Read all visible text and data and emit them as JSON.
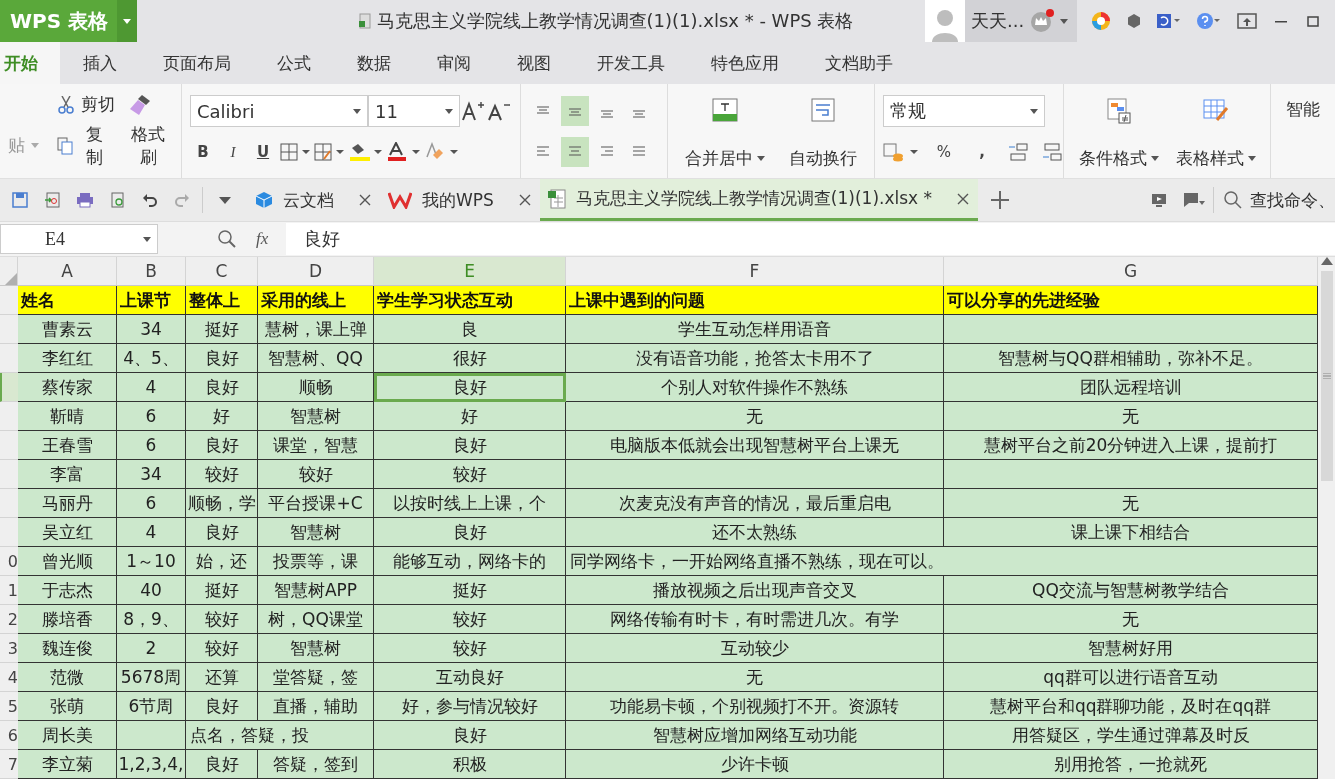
{
  "app_button": {
    "label": "WPS 表格"
  },
  "window": {
    "title": "马克思主义学院线上教学情况调查(1)(1).xlsx * - WPS 表格"
  },
  "user": {
    "name": "天天..."
  },
  "menu_tabs": [
    {
      "label": "开始",
      "selected": true
    },
    {
      "label": "插入",
      "selected": false
    },
    {
      "label": "页面布局",
      "selected": false
    },
    {
      "label": "公式",
      "selected": false
    },
    {
      "label": "数据",
      "selected": false
    },
    {
      "label": "审阅",
      "selected": false
    },
    {
      "label": "视图",
      "selected": false
    },
    {
      "label": "开发工具",
      "selected": false
    },
    {
      "label": "特色应用",
      "selected": false
    },
    {
      "label": "文档助手",
      "selected": false
    }
  ],
  "ribbon": {
    "paste": "贴",
    "cut": "剪切",
    "copy": "复制",
    "format_painter": "格式刷",
    "font_family": "Calibri",
    "font_size": "11",
    "bold": "B",
    "italic": "I",
    "underline": "U",
    "merge_center": "合并居中",
    "wrap_text": "自动换行",
    "number_format": "常规",
    "percent": "%",
    "comma": ",",
    "conditional_format": "条件格式",
    "table_style": "表格样式",
    "smart": "智能"
  },
  "doc_tabs": [
    {
      "label": "云文档",
      "selected": false
    },
    {
      "label": "我的WPS",
      "selected": false
    },
    {
      "label": "马克思主义学院线上教学情况调查(1)(1).xlsx *",
      "selected": true
    }
  ],
  "search": {
    "placeholder": "查找命令、"
  },
  "formula_bar": {
    "cell_ref": "E4",
    "fx": "fx",
    "value": "良好"
  },
  "sheet": {
    "columns": [
      {
        "label": "A",
        "selected": false
      },
      {
        "label": "B",
        "selected": false
      },
      {
        "label": "C",
        "selected": false
      },
      {
        "label": "D",
        "selected": false
      },
      {
        "label": "E",
        "selected": true
      },
      {
        "label": "F",
        "selected": false
      },
      {
        "label": "G",
        "selected": false
      }
    ],
    "header_row": [
      "姓名",
      "上课节",
      "整体上",
      "采用的线上",
      "学生学习状态互动",
      "上课中遇到的问题",
      "可以分享的先进经验"
    ],
    "rows": [
      {
        "selected": false,
        "cells": [
          {
            "text": "曹素云"
          },
          {
            "text": "34"
          },
          {
            "text": "挺好"
          },
          {
            "text": "慧树，课上弹"
          },
          {
            "text": "良"
          },
          {
            "text": "学生互动怎样用语音"
          },
          {
            "text": ""
          }
        ]
      },
      {
        "selected": false,
        "cells": [
          {
            "text": "李红红"
          },
          {
            "text": "4、5、"
          },
          {
            "text": "良好"
          },
          {
            "text": "智慧树、QQ"
          },
          {
            "text": "很好"
          },
          {
            "text": "没有语音功能，抢答太卡用不了"
          },
          {
            "text": "智慧树与QQ群相辅助，弥补不足。"
          }
        ]
      },
      {
        "selected": true,
        "cells": [
          {
            "text": "蔡传家"
          },
          {
            "text": "4"
          },
          {
            "text": "良好"
          },
          {
            "text": "顺畅"
          },
          {
            "text": "良好"
          },
          {
            "text": "个别人对软件操作不熟练"
          },
          {
            "text": "团队远程培训"
          }
        ]
      },
      {
        "selected": false,
        "cells": [
          {
            "text": "靳晴"
          },
          {
            "text": "6"
          },
          {
            "text": "好"
          },
          {
            "text": "智慧树"
          },
          {
            "text": "好"
          },
          {
            "text": "无"
          },
          {
            "text": "无"
          }
        ]
      },
      {
        "selected": false,
        "cells": [
          {
            "text": "王春雪"
          },
          {
            "text": "6"
          },
          {
            "text": "良好"
          },
          {
            "text": "课堂，智慧"
          },
          {
            "text": "良好"
          },
          {
            "text": "电脑版本低就会出现智慧树平台上课无"
          },
          {
            "text": "慧树平台之前20分钟进入上课，提前打"
          }
        ]
      },
      {
        "selected": false,
        "cells": [
          {
            "text": "李富"
          },
          {
            "text": "34"
          },
          {
            "text": "较好"
          },
          {
            "text": "较好"
          },
          {
            "text": "较好"
          },
          {
            "text": ""
          },
          {
            "text": ""
          }
        ]
      },
      {
        "selected": false,
        "cells": [
          {
            "text": "马丽丹"
          },
          {
            "text": "6"
          },
          {
            "text": "顺畅，学"
          },
          {
            "text": "平台授课+C"
          },
          {
            "text": "以按时线上上课，个"
          },
          {
            "text": "次麦克没有声音的情况，最后重启电"
          },
          {
            "text": "无"
          }
        ]
      },
      {
        "selected": false,
        "cells": [
          {
            "text": "吴立红"
          },
          {
            "text": "4"
          },
          {
            "text": "良好"
          },
          {
            "text": "智慧树"
          },
          {
            "text": "良好"
          },
          {
            "text": "还不太熟练"
          },
          {
            "text": "课上课下相结合"
          }
        ]
      },
      {
        "number": "0",
        "selected": false,
        "cells": [
          {
            "text": "曾光顺"
          },
          {
            "text": "1～10"
          },
          {
            "text": "始，还"
          },
          {
            "text": "投票等，课"
          },
          {
            "text": "能够互动，网络卡的"
          },
          {
            "text": "同学网络卡，一开始网络直播不熟练，现在可以。",
            "kind": "spill"
          },
          {
            "text": ""
          }
        ]
      },
      {
        "number": "1",
        "selected": false,
        "cells": [
          {
            "text": "于志杰"
          },
          {
            "text": "40"
          },
          {
            "text": "挺好"
          },
          {
            "text": "智慧树APP"
          },
          {
            "text": "挺好"
          },
          {
            "text": "播放视频之后出现声音交叉"
          },
          {
            "text": "QQ交流与智慧树教学结合"
          }
        ]
      },
      {
        "number": "2",
        "selected": false,
        "cells": [
          {
            "text": "滕培香"
          },
          {
            "text": "8，9、"
          },
          {
            "text": "较好"
          },
          {
            "text": "树，QQ课堂"
          },
          {
            "text": "较好"
          },
          {
            "text": "网络传输有时卡，有时需进几次。有学"
          },
          {
            "text": "无"
          }
        ]
      },
      {
        "number": "3",
        "selected": false,
        "cells": [
          {
            "text": "魏连俊"
          },
          {
            "text": "2"
          },
          {
            "text": "较好"
          },
          {
            "text": "智慧树"
          },
          {
            "text": "较好"
          },
          {
            "text": "互动较少"
          },
          {
            "text": "智慧树好用"
          }
        ]
      },
      {
        "number": "4",
        "selected": false,
        "cells": [
          {
            "text": "范微"
          },
          {
            "text": "5678周"
          },
          {
            "text": "还算"
          },
          {
            "text": "堂答疑，签"
          },
          {
            "text": "互动良好"
          },
          {
            "text": "无"
          },
          {
            "text": "qq群可以进行语音互动"
          }
        ]
      },
      {
        "number": "5",
        "selected": false,
        "cells": [
          {
            "text": "张萌"
          },
          {
            "text": "6节周"
          },
          {
            "text": "良好"
          },
          {
            "text": "直播，辅助"
          },
          {
            "text": "好，参与情况较好"
          },
          {
            "text": "功能易卡顿，个别视频打不开。资源转"
          },
          {
            "text": "慧树平台和qq群聊功能，及时在qq群"
          }
        ]
      },
      {
        "number": "6",
        "selected": false,
        "cells": [
          {
            "text": "周长美"
          },
          {
            "text": ""
          },
          {
            "text": "点名，答疑，投",
            "kind": "spill"
          },
          {
            "text": ""
          },
          {
            "text": "良好"
          },
          {
            "text": "智慧树应增加网络互动功能"
          },
          {
            "text": "用答疑区，学生通过弹幕及时反"
          }
        ]
      },
      {
        "number": "7",
        "selected": false,
        "cells": [
          {
            "text": "李立菊"
          },
          {
            "text": "1,2,3,4,"
          },
          {
            "text": "良好"
          },
          {
            "text": "答疑，签到"
          },
          {
            "text": "积极"
          },
          {
            "text": "少许卡顿"
          },
          {
            "text": "别用抢答，一抢就死"
          }
        ]
      }
    ]
  }
}
